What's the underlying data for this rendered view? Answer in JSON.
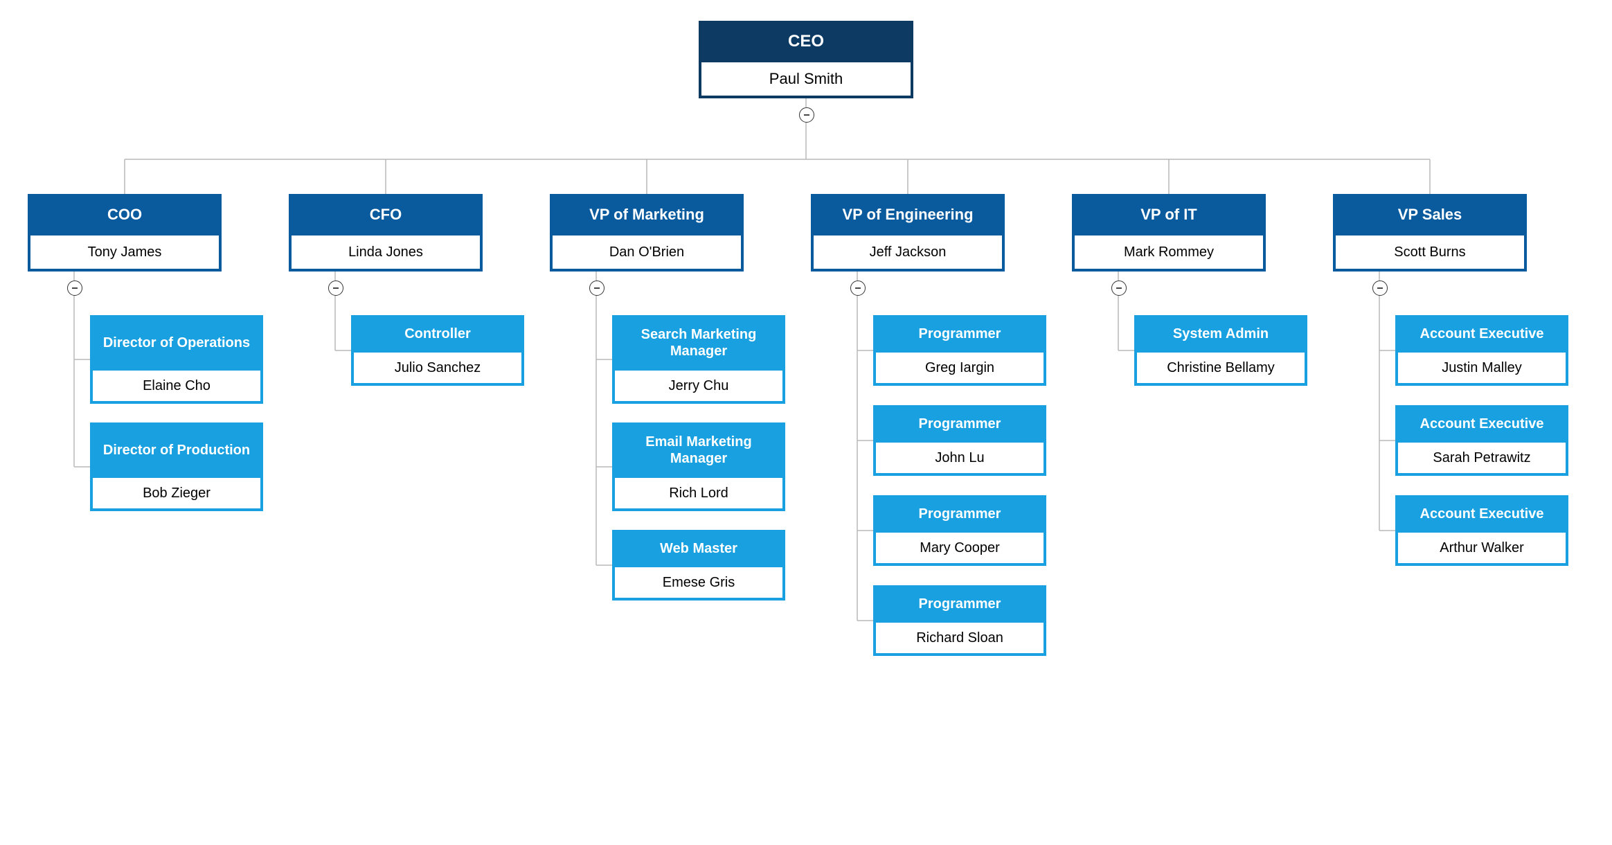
{
  "colors": {
    "level0": "#0c3a63",
    "level1": "#0a5a9e",
    "level2": "#19a0e0",
    "line": "#b8b8b8"
  },
  "root": {
    "title": "CEO",
    "name": "Paul Smith"
  },
  "branches": [
    {
      "id": "coo",
      "title": "COO",
      "name": "Tony James",
      "children": [
        {
          "title": "Director of Operations",
          "name": "Elaine Cho",
          "twoLine": true
        },
        {
          "title": "Director of Production",
          "name": "Bob Zieger",
          "twoLine": true
        }
      ]
    },
    {
      "id": "cfo",
      "title": "CFO",
      "name": "Linda Jones",
      "children": [
        {
          "title": "Controller",
          "name": "Julio Sanchez"
        }
      ]
    },
    {
      "id": "vpmkt",
      "title": "VP of Marketing",
      "name": "Dan O'Brien",
      "children": [
        {
          "title": "Search Marketing Manager",
          "name": "Jerry Chu",
          "twoLine": true
        },
        {
          "title": "Email Marketing Manager",
          "name": "Rich Lord",
          "twoLine": true
        },
        {
          "title": "Web Master",
          "name": "Emese Gris"
        }
      ]
    },
    {
      "id": "vpeng",
      "title": "VP of Engineering",
      "name": "Jeff Jackson",
      "children": [
        {
          "title": "Programmer",
          "name": "Greg Iargin"
        },
        {
          "title": "Programmer",
          "name": "John Lu"
        },
        {
          "title": "Programmer",
          "name": "Mary Cooper"
        },
        {
          "title": "Programmer",
          "name": "Richard Sloan"
        }
      ]
    },
    {
      "id": "vpit",
      "title": "VP of IT",
      "name": "Mark Rommey",
      "children": [
        {
          "title": "System Admin",
          "name": "Christine Bellamy"
        }
      ]
    },
    {
      "id": "vpsales",
      "title": "VP Sales",
      "name": "Scott Burns",
      "children": [
        {
          "title": "Account Executive",
          "name": "Justin Malley"
        },
        {
          "title": "Account Executive",
          "name": "Sarah Petrawitz"
        },
        {
          "title": "Account Executive",
          "name": "Arthur Walker"
        }
      ]
    }
  ]
}
